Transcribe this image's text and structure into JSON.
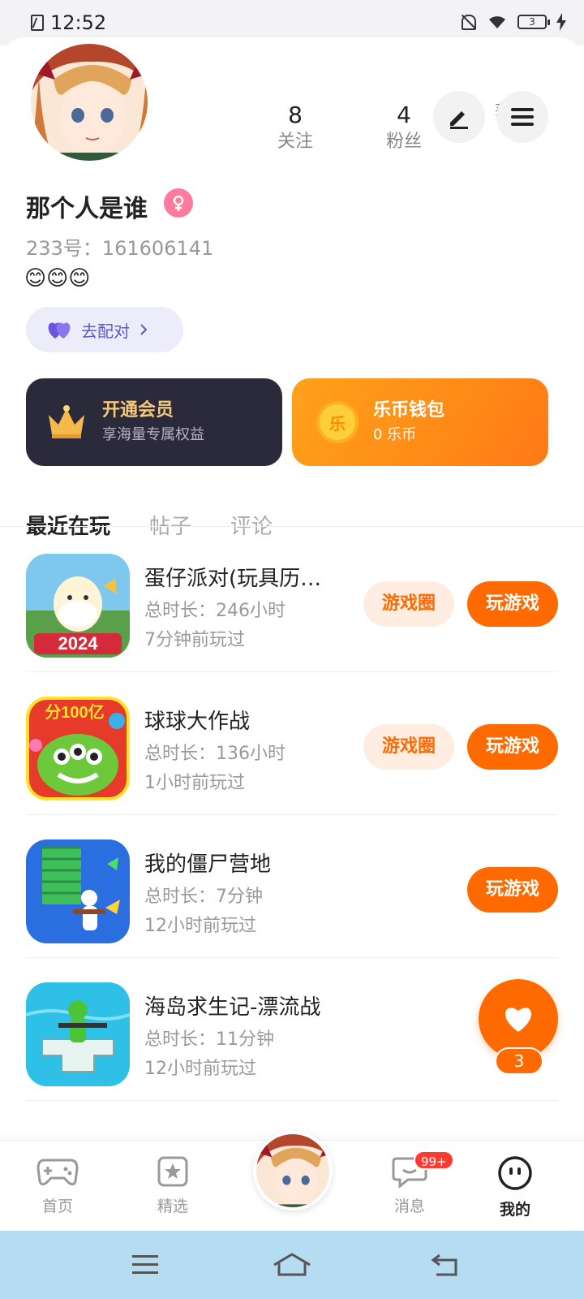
{
  "status_bar": {
    "time": "12:52",
    "battery": "3"
  },
  "profile": {
    "name": "那个人是谁",
    "uid": "233号：161606141",
    "signature": "😊😊😊",
    "stats": [
      {
        "value": "8",
        "label": "关注"
      },
      {
        "value": "4",
        "label": "粉丝"
      },
      {
        "value": "",
        "label": "获赞"
      }
    ],
    "match_button": "去配对"
  },
  "cards": {
    "vip": {
      "title": "开通会员",
      "subtitle": "享海量专属权益"
    },
    "wallet": {
      "title": "乐币钱包",
      "subtitle": "0 乐币",
      "coin_glyph": "乐"
    }
  },
  "tabs": [
    "最近在玩",
    "帖子",
    "评论"
  ],
  "games": [
    {
      "name": "蛋仔派对(玩具历…",
      "total_time": "总时长：246小时",
      "last_played": "7分钟前玩过",
      "circle_label": "游戏圈",
      "play_label": "玩游戏",
      "icon_text": "2024"
    },
    {
      "name": "球球大作战",
      "total_time": "总时长：136小时",
      "last_played": "1小时前玩过",
      "circle_label": "游戏圈",
      "play_label": "玩游戏",
      "icon_text": "分100亿"
    },
    {
      "name": "我的僵尸营地",
      "total_time": "总时长：7分钟",
      "last_played": "12小时前玩过",
      "play_label": "玩游戏"
    },
    {
      "name": "海岛求生记-漂流战",
      "total_time": "总时长：11分钟",
      "last_played": "12小时前玩过"
    }
  ],
  "floating_like": {
    "count": "3"
  },
  "bottom_nav": {
    "items": [
      {
        "label": "首页"
      },
      {
        "label": "精选"
      },
      {
        "label": "消息",
        "badge": "99+"
      },
      {
        "label": "我的"
      }
    ]
  },
  "colors": {
    "accent": "#ff6a00",
    "vip_dark": "#2b2a3b",
    "system_bar": "#b6dcf1"
  }
}
